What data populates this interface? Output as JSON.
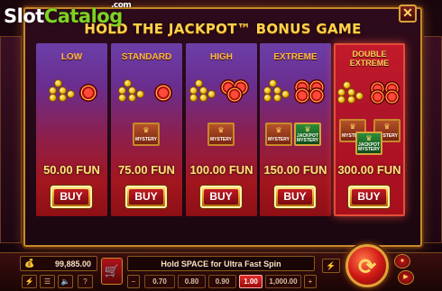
{
  "watermark": {
    "slot": "Slot",
    "catalog": "Catalog",
    "com": ".com"
  },
  "bonus_panel": {
    "title": "HOLD THE JACKPOT™ BONUS GAME",
    "close": "✕",
    "options": [
      {
        "label": "LOW",
        "price": "50.00 FUN",
        "buy": "BUY"
      },
      {
        "label": "STANDARD",
        "price": "75.00 FUN",
        "buy": "BUY"
      },
      {
        "label": "HIGH",
        "price": "100.00 FUN",
        "buy": "BUY"
      },
      {
        "label": "EXTREME",
        "price": "150.00 FUN",
        "buy": "BUY"
      },
      {
        "label_line1": "DOUBLE",
        "label_line2": "EXTREME",
        "price": "300.00 FUN",
        "buy": "BUY"
      }
    ],
    "mystery_text": "MYSTERY",
    "jackpot_mystery_text_1": "JACKPOT",
    "jackpot_mystery_text_2": "MYSTERY"
  },
  "hud": {
    "balance": "99,885.00",
    "spin_hint": "Hold SPACE for Ultra Fast Spin",
    "bets": [
      "0.70",
      "0.80",
      "0.90",
      "1.00",
      "1,000.00"
    ],
    "active_bet": "1.00",
    "help": "?"
  },
  "colors": {
    "gold": "#ffd24a",
    "accent_red": "#c21a1a",
    "frame": "#c68a2a"
  }
}
